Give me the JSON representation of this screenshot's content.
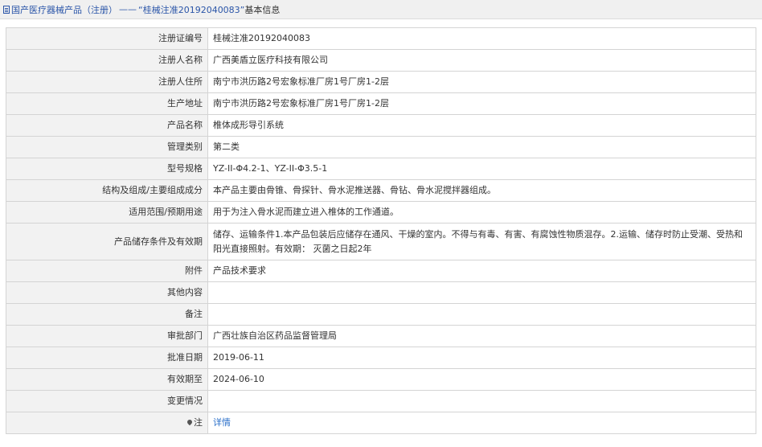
{
  "breadcrumb": {
    "home": "国产医疗器械产品（注册）",
    "separator": "——",
    "current_link": "“桂械注准20192040083”",
    "current": "基本信息"
  },
  "rows": [
    {
      "label": "注册证编号",
      "value": "桂械注准20192040083"
    },
    {
      "label": "注册人名称",
      "value": "广西美盾立医疗科技有限公司"
    },
    {
      "label": "注册人住所",
      "value": "南宁市洪历路2号宏象标准厂房1号厂房1-2层"
    },
    {
      "label": "生产地址",
      "value": "南宁市洪历路2号宏象标准厂房1号厂房1-2层"
    },
    {
      "label": "产品名称",
      "value": "椎体成形导引系统"
    },
    {
      "label": "管理类别",
      "value": "第二类"
    },
    {
      "label": "型号规格",
      "value": "YZ-II-Φ4.2-1、YZ-II-Φ3.5-1"
    },
    {
      "label": "结构及组成/主要组成成分",
      "value": "本产品主要由骨锥、骨探针、骨水泥推送器、骨钻、骨水泥搅拌器组成。"
    },
    {
      "label": "适用范围/预期用途",
      "value": "用于为注入骨水泥而建立进入椎体的工作通道。"
    },
    {
      "label": "产品储存条件及有效期",
      "value": "储存、运输条件1.本产品包装后应储存在通风、干燥的室内。不得与有毒、有害、有腐蚀性物质混存。2.运输、储存时防止受潮、受热和阳光直接照射。有效期： 灭菌之日起2年"
    },
    {
      "label": "附件",
      "value": "产品技术要求"
    },
    {
      "label": "其他内容",
      "value": ""
    },
    {
      "label": "备注",
      "value": ""
    },
    {
      "label": "审批部门",
      "value": "广西壮族自治区药品监督管理局"
    },
    {
      "label": "批准日期",
      "value": "2019-06-11"
    },
    {
      "label": "有效期至",
      "value": "2024-06-10"
    },
    {
      "label": "变更情况",
      "value": ""
    },
    {
      "label": "注",
      "value": "详情"
    }
  ]
}
